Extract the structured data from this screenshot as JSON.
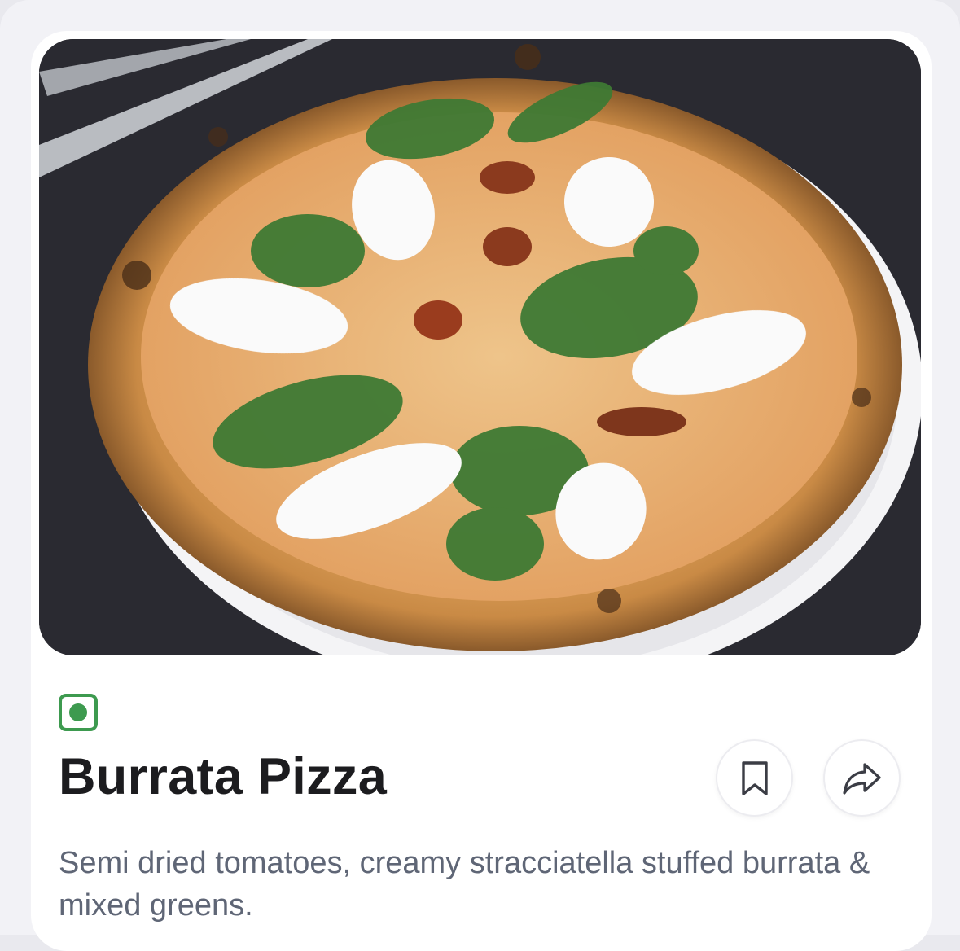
{
  "item": {
    "name": "Burrata Pizza",
    "description": "Semi dried tomatoes, creamy stracciatella stuffed burrata & mixed greens.",
    "diet_indicator": "veg-indicator-icon",
    "image": "pizza-photo"
  },
  "actions": {
    "bookmark_icon": "bookmark-icon",
    "share_icon": "share-icon"
  },
  "colors": {
    "veg_green": "#3d9a4f",
    "title": "#1c1c1f",
    "description": "#5f6676"
  }
}
